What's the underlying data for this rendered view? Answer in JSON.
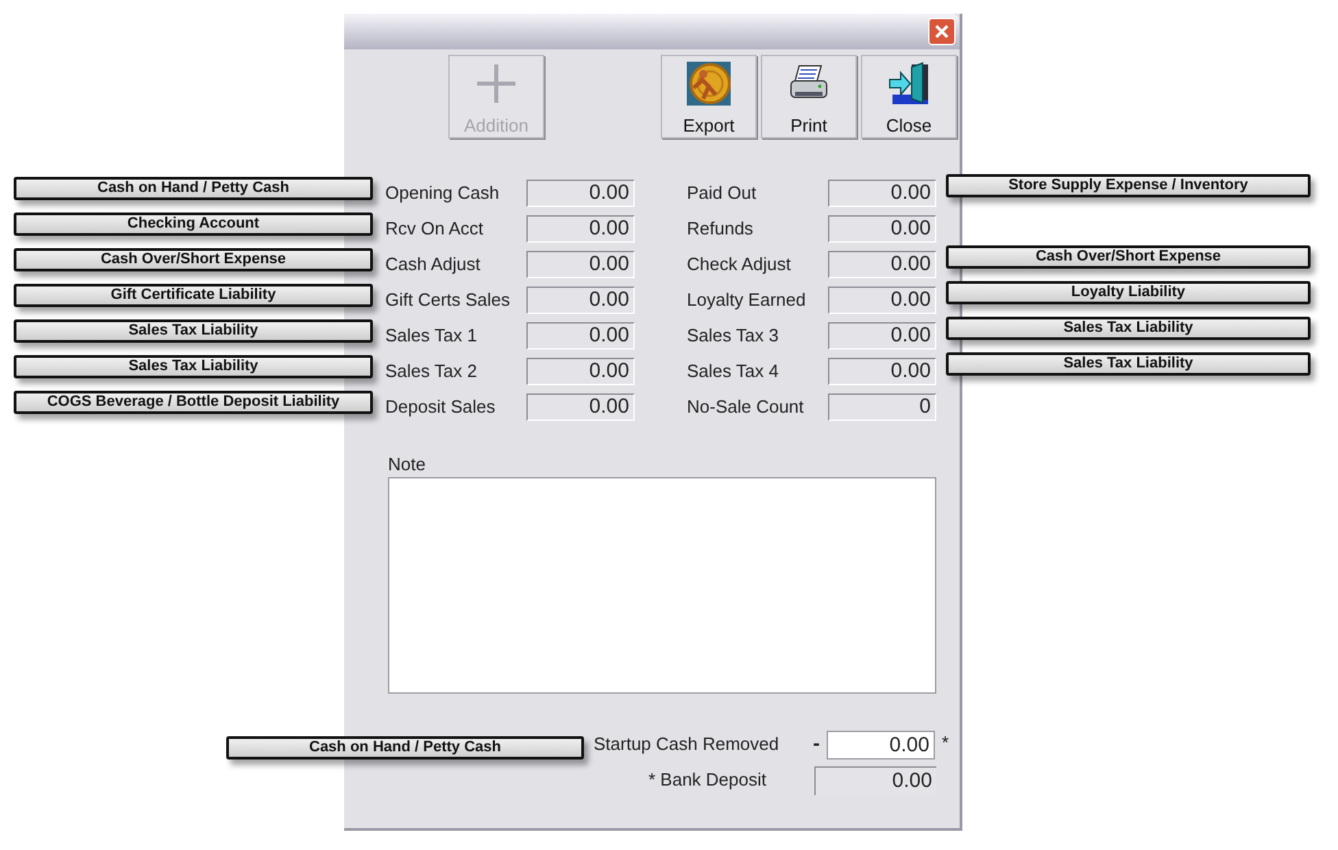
{
  "toolbar": [
    {
      "kind": "plus",
      "label": "Addition",
      "disabled": true
    },
    {
      "kind": "export",
      "label": "Export",
      "disabled": false
    },
    {
      "kind": "print",
      "label": "Print",
      "disabled": false
    },
    {
      "kind": "exit",
      "label": "Close",
      "disabled": false
    }
  ],
  "fields_left": [
    {
      "label": "Opening Cash",
      "value": "0.00",
      "callout": "Cash on Hand / Petty Cash"
    },
    {
      "label": "Rcv On Acct",
      "value": "0.00",
      "callout": "Checking Account"
    },
    {
      "label": "Cash Adjust",
      "value": "0.00",
      "callout": "Cash Over/Short Expense"
    },
    {
      "label": "Gift Certs Sales",
      "value": "0.00",
      "callout": "Gift Certificate Liability"
    },
    {
      "label": "Sales Tax 1",
      "value": "0.00",
      "callout": "Sales Tax Liability"
    },
    {
      "label": "Sales Tax 2",
      "value": "0.00",
      "callout": "Sales Tax Liability"
    },
    {
      "label": "Deposit Sales",
      "value": "0.00",
      "callout": "COGS Beverage / Bottle Deposit Liability"
    }
  ],
  "fields_right": [
    {
      "label": "Paid Out",
      "value": "0.00",
      "callout": "Store Supply Expense / Inventory"
    },
    {
      "label": "Refunds",
      "value": "0.00"
    },
    {
      "label": "Check Adjust",
      "value": "0.00",
      "callout": "Cash Over/Short Expense"
    },
    {
      "label": "Loyalty Earned",
      "value": "0.00",
      "callout": "Loyalty Liability"
    },
    {
      "label": "Sales Tax 3",
      "value": "0.00",
      "callout": "Sales Tax Liability"
    },
    {
      "label": "Sales Tax 4",
      "value": "0.00",
      "callout": "Sales Tax Liability"
    },
    {
      "label": "No-Sale Count",
      "value": "0"
    }
  ],
  "note": {
    "label": "Note"
  },
  "startup_cash": {
    "label": "Startup Cash Removed",
    "sign": "-",
    "value": "0.00",
    "footnote": "*",
    "callout": "Cash on Hand / Petty Cash"
  },
  "bank_deposit": {
    "label": "* Bank Deposit",
    "value": "0.00"
  }
}
